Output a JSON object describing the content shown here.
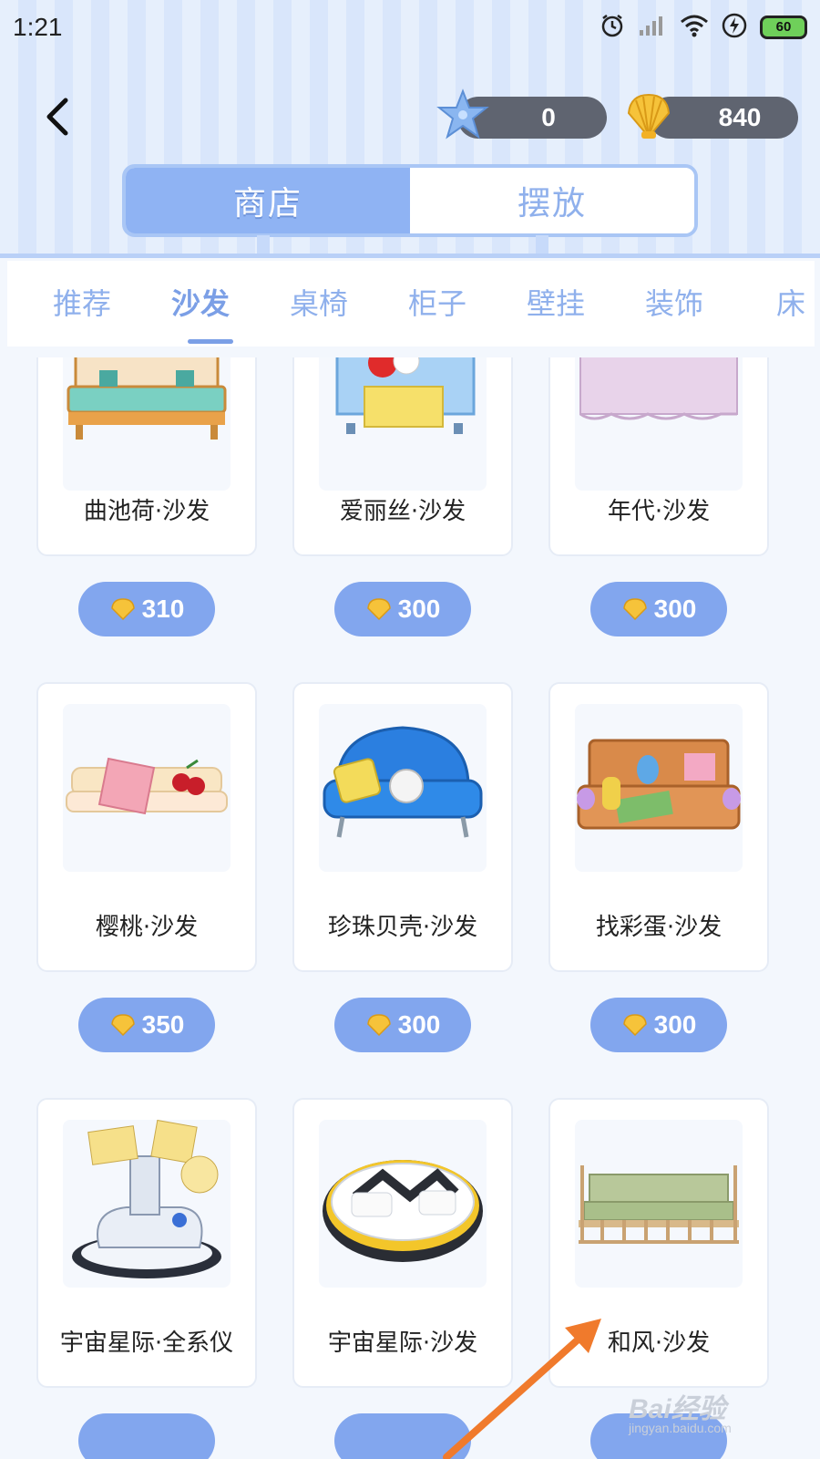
{
  "status_bar": {
    "time": "1:21",
    "battery": "60"
  },
  "currency": {
    "stars": "0",
    "shells": "840"
  },
  "segment_tabs": [
    {
      "label": "商店",
      "active": true
    },
    {
      "label": "摆放",
      "active": false
    }
  ],
  "categories": [
    {
      "label": "推荐"
    },
    {
      "label": "沙发",
      "active": true
    },
    {
      "label": "桌椅"
    },
    {
      "label": "柜子"
    },
    {
      "label": "壁挂"
    },
    {
      "label": "装饰"
    },
    {
      "label": "床"
    }
  ],
  "items": [
    {
      "name": "曲池荷·沙发",
      "price": "310"
    },
    {
      "name": "爱丽丝·沙发",
      "price": "300"
    },
    {
      "name": "年代·沙发",
      "price": "300"
    },
    {
      "name": "樱桃·沙发",
      "price": "350"
    },
    {
      "name": "珍珠贝壳·沙发",
      "price": "300"
    },
    {
      "name": "找彩蛋·沙发",
      "price": "300"
    },
    {
      "name": "宇宙星际·全系仪",
      "price": ""
    },
    {
      "name": "宇宙星际·沙发",
      "price": ""
    },
    {
      "name": "和风·沙发",
      "price": ""
    }
  ],
  "watermark": {
    "brand": "Bai经验",
    "url": "jingyan.baidu.com"
  },
  "colors": {
    "accent": "#82a6ee",
    "tab_active": "#8fb3f3",
    "category_text": "#8fb0ec",
    "arrow": "#f07a2c"
  }
}
